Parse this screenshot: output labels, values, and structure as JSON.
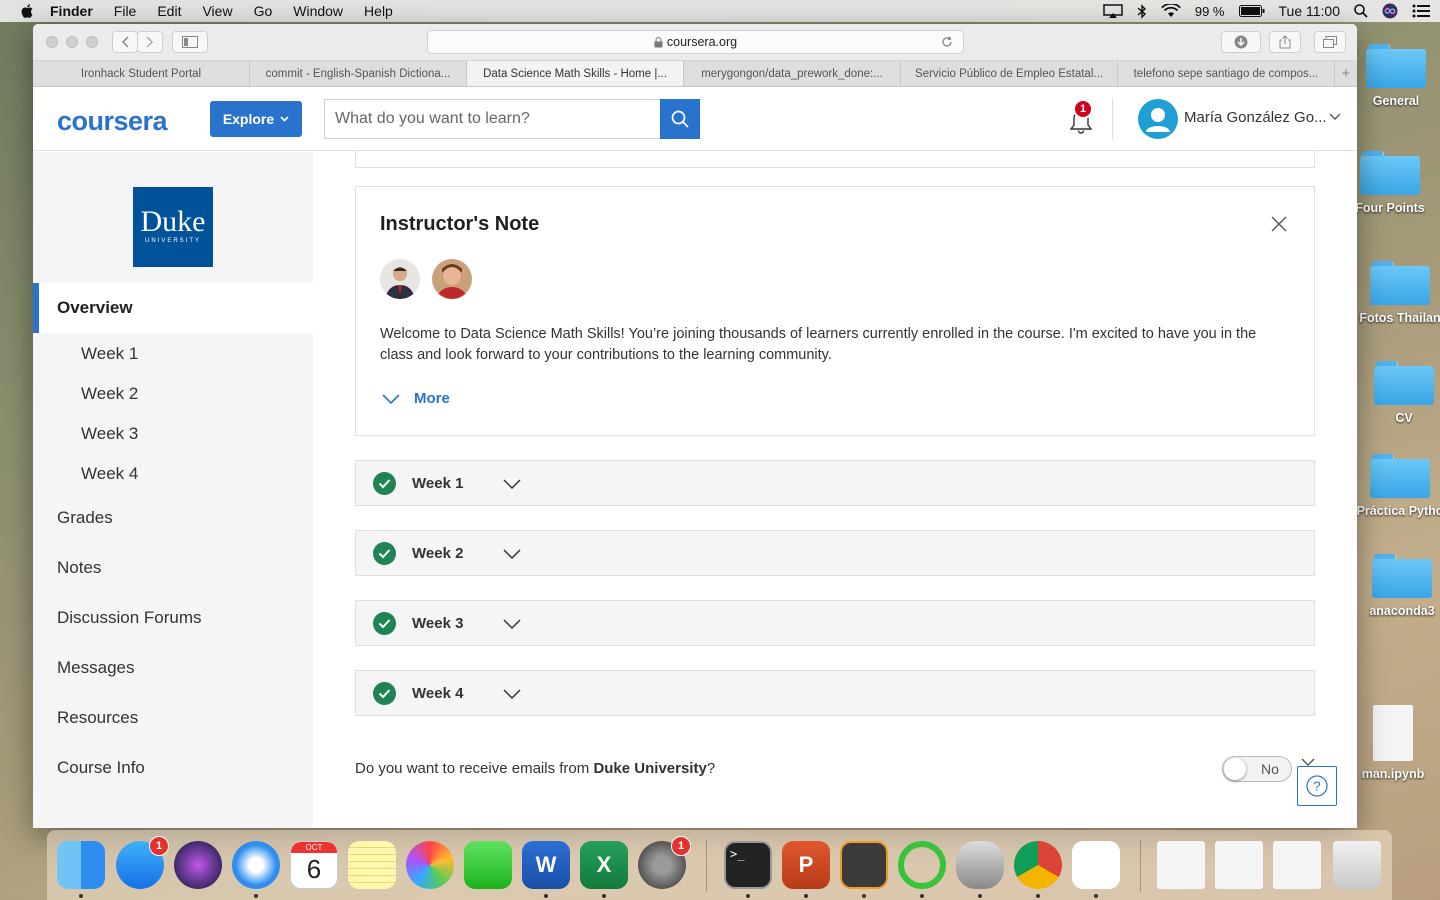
{
  "menubar": {
    "app_name": "Finder",
    "items": [
      "File",
      "Edit",
      "View",
      "Go",
      "Window",
      "Help"
    ],
    "battery": "99 %",
    "clock": "Tue 11:00"
  },
  "desktop": {
    "items": [
      "General",
      "Four Points",
      "Fotos Thailan",
      "CV",
      "Práctica Pytho",
      "anaconda3",
      "man.ipynb"
    ]
  },
  "browser": {
    "url": "coursera.org",
    "tabs": [
      "Ironhack Student Portal",
      "commit - English-Spanish Dictiona...",
      "Data Science Math Skills - Home |...",
      "merygongon/data_prework_done:...",
      "Servicio Público de Empleo Estatal...",
      "telefono sepe santiago de compos..."
    ],
    "new_tab": "+"
  },
  "header": {
    "logo": "coursera",
    "explore_label": "Explore",
    "search_placeholder": "What do you want to learn?",
    "notification_count": "1",
    "user_name": "María González Go..."
  },
  "sidebar": {
    "university_name": "Duke",
    "university_sub": "UNIVERSITY",
    "items": [
      {
        "label": "Overview"
      },
      {
        "label": "Week 1"
      },
      {
        "label": "Week 2"
      },
      {
        "label": "Week 3"
      },
      {
        "label": "Week 4"
      },
      {
        "label": "Grades"
      },
      {
        "label": "Notes"
      },
      {
        "label": "Discussion Forums"
      },
      {
        "label": "Messages"
      },
      {
        "label": "Resources"
      },
      {
        "label": "Course Info"
      }
    ]
  },
  "note": {
    "title": "Instructor's Note",
    "text": "Welcome to Data Science Math Skills! You’re joining thousands of learners currently enrolled in the course. I'm excited to have you in the class and look forward to your contributions to the learning community.",
    "more_label": "More"
  },
  "weeks": [
    {
      "label": "Week 1",
      "completed": true
    },
    {
      "label": "Week 2",
      "completed": true
    },
    {
      "label": "Week 3",
      "completed": true
    },
    {
      "label": "Week 4",
      "completed": true
    }
  ],
  "email_pref": {
    "question_prefix": "Do you want to receive emails from ",
    "university": "Duke University",
    "question_suffix": "?",
    "toggle_label": "No"
  },
  "dock": {
    "calendar_month": "OCT",
    "calendar_day": "6",
    "appstore_badge": "1",
    "settings_badge": "1",
    "word_letter": "W",
    "excel_letter": "X",
    "ppt_letter": "P",
    "terminal_prompt": ">_"
  },
  "colors": {
    "accent": "#2a73cc",
    "success": "#1f8354",
    "badge": "#d0021b",
    "duke_blue": "#00539b"
  }
}
